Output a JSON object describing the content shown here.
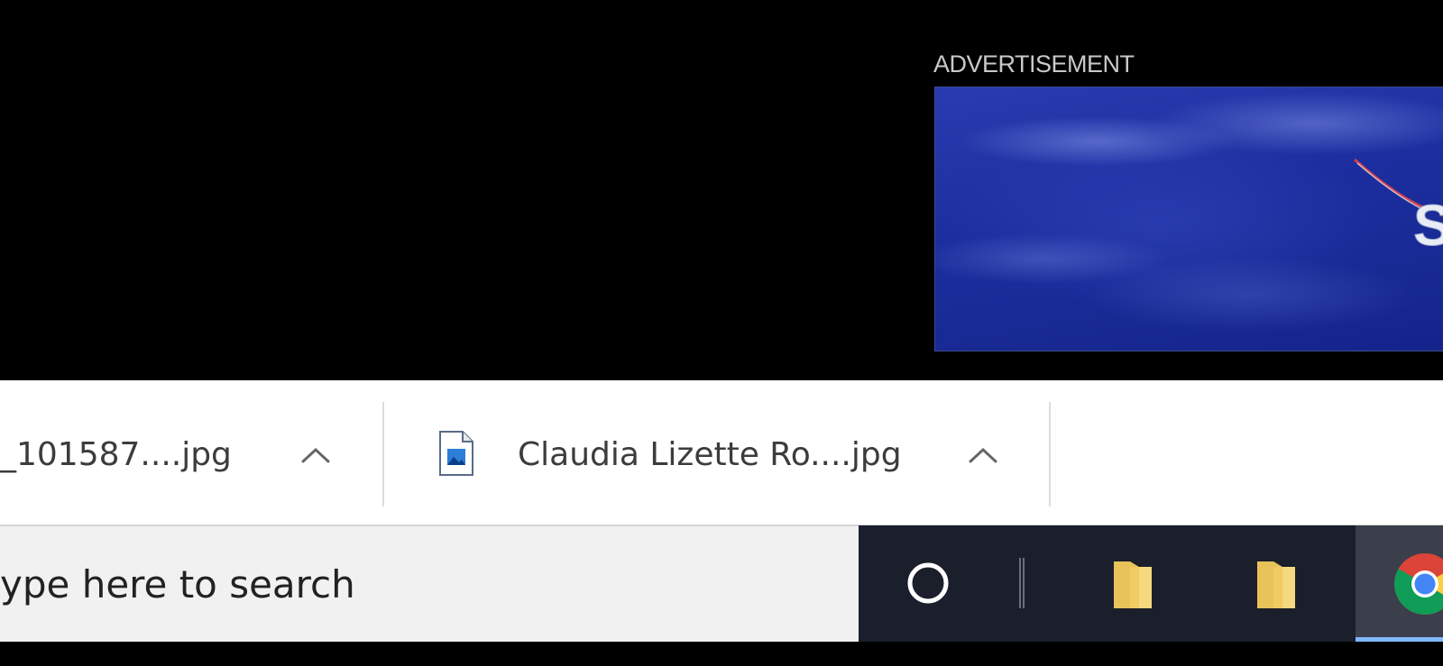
{
  "advertisement": {
    "label": "ADVERTISEMENT"
  },
  "download_shelf": {
    "items": [
      {
        "filename": "_101587....jpg",
        "icon": "image-file-icon"
      },
      {
        "filename": "Claudia Lizette Ro....jpg",
        "icon": "image-file-icon"
      }
    ],
    "menu_icon": "chevron-up-icon"
  },
  "taskbar": {
    "search_placeholder": "ype here to search",
    "icons": [
      "cortana-circle-icon",
      "file-explorer-icon",
      "file-explorer-icon",
      "chrome-icon"
    ],
    "active_underline_color": "#7fb8ff"
  },
  "colors": {
    "page_background": "#000000",
    "ad_blue": "#1d2fa0",
    "shelf_background": "#ffffff",
    "taskbar_background": "#1a1f2b",
    "search_background": "#f1f1f1"
  }
}
